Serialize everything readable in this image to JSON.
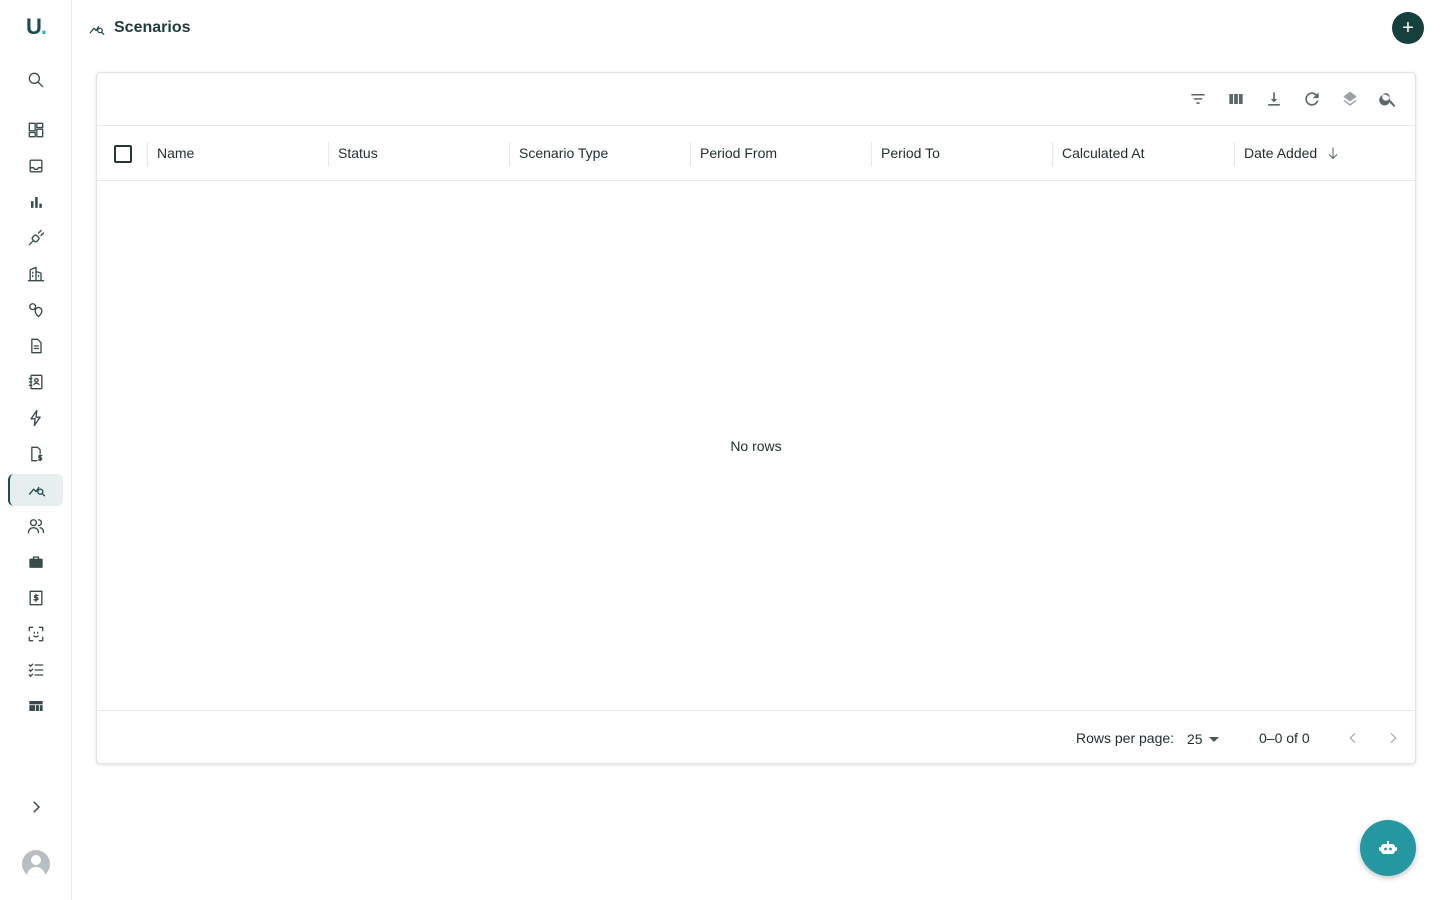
{
  "brand": {
    "logo_text": "U",
    "logo_dot": ".",
    "accent": "#2bb3b8",
    "primary": "#15403d"
  },
  "header": {
    "title": "Scenarios",
    "icon": "scenario-chart-icon",
    "add_label": "+"
  },
  "sidebar": {
    "items": [
      {
        "name": "search",
        "icon": "search-icon"
      },
      {
        "name": "dashboard",
        "icon": "dashboard-icon"
      },
      {
        "name": "inbox",
        "icon": "inbox-icon"
      },
      {
        "name": "reports",
        "icon": "bar-chart-icon"
      },
      {
        "name": "integrations",
        "icon": "plug-icon"
      },
      {
        "name": "buildings",
        "icon": "building-icon"
      },
      {
        "name": "locations",
        "icon": "location-icon"
      },
      {
        "name": "documents",
        "icon": "document-icon"
      },
      {
        "name": "contacts",
        "icon": "contact-book-icon"
      },
      {
        "name": "energy",
        "icon": "lightning-icon"
      },
      {
        "name": "billing",
        "icon": "billing-icon"
      },
      {
        "name": "scenarios",
        "icon": "scenario-chart-icon",
        "active": true
      },
      {
        "name": "users",
        "icon": "users-icon"
      },
      {
        "name": "work",
        "icon": "briefcase-icon"
      },
      {
        "name": "invoices",
        "icon": "invoice-icon"
      },
      {
        "name": "scan",
        "icon": "scan-icon"
      },
      {
        "name": "checklist",
        "icon": "checklist-icon"
      },
      {
        "name": "boards",
        "icon": "board-icon"
      }
    ]
  },
  "grid": {
    "toolbar": [
      "filter-icon",
      "columns-icon",
      "download-icon",
      "refresh-icon",
      "layers-icon",
      "search-icon"
    ],
    "columns": [
      "Name",
      "Status",
      "Scenario Type",
      "Period From",
      "Period To",
      "Calculated At",
      "Date Added"
    ],
    "sort_column": "Date Added",
    "empty_text": "No rows",
    "footer": {
      "rows_per_page_label": "Rows per page:",
      "rows_per_page": "25",
      "range_text": "0–0 of 0"
    }
  },
  "fab": {
    "icon": "bot-icon"
  }
}
